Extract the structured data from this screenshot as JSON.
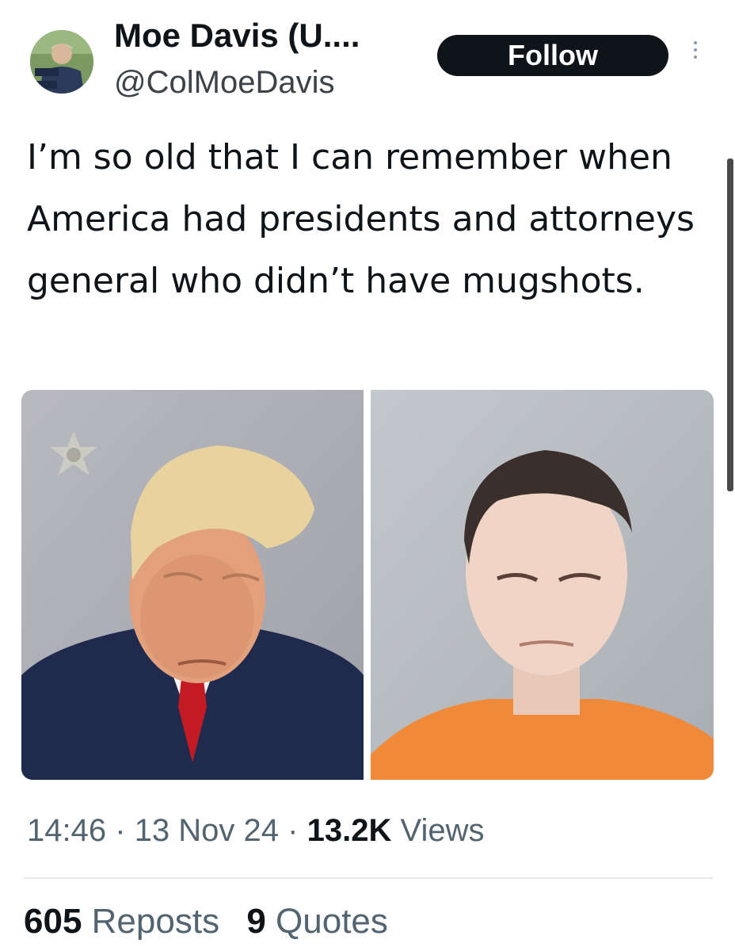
{
  "author": {
    "display_name": "Moe Davis (U....",
    "handle": "@ColMoeDavis",
    "avatar_icon": "profile-photo"
  },
  "follow_button": {
    "label": "Follow"
  },
  "more_menu": {
    "icon": "more-vertical-icon"
  },
  "tweet": {
    "text": "I’m so old that I can remember when America had presidents and attorneys general who didn’t have mugshots."
  },
  "media": {
    "images": [
      {
        "name": "mugshot-left",
        "description_icon": "photo"
      },
      {
        "name": "mugshot-right",
        "description_icon": "photo"
      }
    ]
  },
  "meta": {
    "time": "14:46",
    "date": "13 Nov 24",
    "views_count": "13.2K",
    "views_label": "Views",
    "separator": "·"
  },
  "stats": {
    "reposts_count": "605",
    "reposts_label": "Reposts",
    "quotes_count": "9",
    "quotes_label": "Quotes"
  },
  "colors": {
    "text": "#0f1419",
    "secondary": "#536471",
    "button_bg": "#0f1419",
    "button_text": "#ffffff"
  }
}
